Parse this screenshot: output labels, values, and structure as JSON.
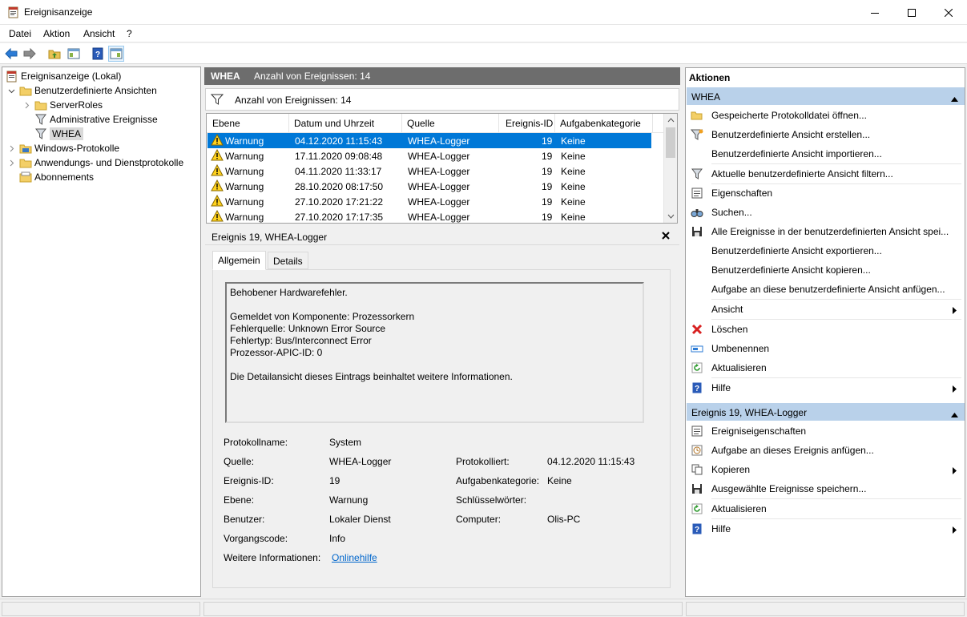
{
  "window": {
    "title": "Ereignisanzeige"
  },
  "menu": [
    "Datei",
    "Aktion",
    "Ansicht",
    "?"
  ],
  "tree": {
    "items": [
      {
        "label": "Ereignisanzeige (Lokal)"
      },
      {
        "label": "Benutzerdefinierte Ansichten"
      },
      {
        "label": "ServerRoles"
      },
      {
        "label": "Administrative Ereignisse"
      },
      {
        "label": "WHEA"
      },
      {
        "label": "Windows-Protokolle"
      },
      {
        "label": "Anwendungs- und Dienstprotokolle"
      },
      {
        "label": "Abonnements"
      }
    ]
  },
  "main": {
    "header_name": "WHEA",
    "header_count": "Anzahl von Ereignissen: 14",
    "filter_text": "Anzahl von Ereignissen: 14",
    "columns": [
      "Ebene",
      "Datum und Uhrzeit",
      "Quelle",
      "Ereignis-ID",
      "Aufgabenkategorie"
    ],
    "rows": [
      {
        "level": "Warnung",
        "date": "04.12.2020 11:15:43",
        "source": "WHEA-Logger",
        "id": "19",
        "category": "Keine"
      },
      {
        "level": "Warnung",
        "date": "17.11.2020 09:08:48",
        "source": "WHEA-Logger",
        "id": "19",
        "category": "Keine"
      },
      {
        "level": "Warnung",
        "date": "04.11.2020 11:33:17",
        "source": "WHEA-Logger",
        "id": "19",
        "category": "Keine"
      },
      {
        "level": "Warnung",
        "date": "28.10.2020 08:17:50",
        "source": "WHEA-Logger",
        "id": "19",
        "category": "Keine"
      },
      {
        "level": "Warnung",
        "date": "27.10.2020 17:21:22",
        "source": "WHEA-Logger",
        "id": "19",
        "category": "Keine"
      },
      {
        "level": "Warnung",
        "date": "27.10.2020 17:17:35",
        "source": "WHEA-Logger",
        "id": "19",
        "category": "Keine"
      }
    ]
  },
  "detail": {
    "title": "Ereignis 19, WHEA-Logger",
    "tabs": [
      "Allgemein",
      "Details"
    ],
    "description": "Behobener Hardwarefehler.\n\nGemeldet von Komponente: Prozessorkern\nFehlerquelle: Unknown Error Source\nFehlertyp: Bus/Interconnect Error\nProzessor-APIC-ID: 0\n\nDie Detailansicht dieses Eintrags beinhaltet weitere Informationen.",
    "props": {
      "log_name_label": "Protokollname:",
      "log_name": "System",
      "source_label": "Quelle:",
      "source": "WHEA-Logger",
      "logged_label": "Protokolliert:",
      "logged": "04.12.2020 11:15:43",
      "event_id_label": "Ereignis-ID:",
      "event_id": "19",
      "task_label": "Aufgabenkategorie:",
      "task": "Keine",
      "level_label": "Ebene:",
      "level": "Warnung",
      "keywords_label": "Schlüsselwörter:",
      "user_label": "Benutzer:",
      "user": "Lokaler Dienst",
      "computer_label": "Computer:",
      "computer": "Olis-PC",
      "opcode_label": "Vorgangscode:",
      "opcode": "Info",
      "more_info_label": "Weitere Informationen:",
      "more_info_link": "Onlinehilfe"
    }
  },
  "actions": {
    "title": "Aktionen",
    "section1": "WHEA",
    "items1": [
      "Gespeicherte Protokolldatei öffnen...",
      "Benutzerdefinierte Ansicht erstellen...",
      "Benutzerdefinierte Ansicht importieren...",
      "Aktuelle benutzerdefinierte Ansicht filtern...",
      "Eigenschaften",
      "Suchen...",
      "Alle Ereignisse in der benutzerdefinierten Ansicht spei...",
      "Benutzerdefinierte Ansicht exportieren...",
      "Benutzerdefinierte Ansicht kopieren...",
      "Aufgabe an diese benutzerdefinierte Ansicht anfügen...",
      "Ansicht",
      "Löschen",
      "Umbenennen",
      "Aktualisieren",
      "Hilfe"
    ],
    "section2": "Ereignis 19, WHEA-Logger",
    "items2": [
      "Ereigniseigenschaften",
      "Aufgabe an dieses Ereignis anfügen...",
      "Kopieren",
      "Ausgewählte Ereignisse speichern...",
      "Aktualisieren",
      "Hilfe"
    ]
  }
}
